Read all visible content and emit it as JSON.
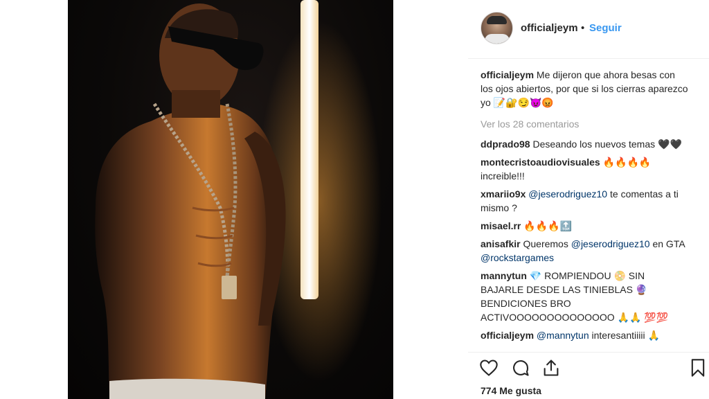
{
  "post": {
    "username": "officialjeym",
    "dot": "•",
    "follow_label": "Seguir",
    "caption_user": "officialjeym",
    "caption_text": "Me dijeron que ahora besas con los ojos abiertos, por que si los cierras aparezco yo",
    "caption_emojis": "📝🔐😏😈😡",
    "view_comments": "Ver los 28 comentarios",
    "likes": "774 Me gusta"
  },
  "comments": [
    {
      "user": "ddprado98",
      "text": "Deseando los nuevos temas",
      "emoji": "🖤🖤"
    },
    {
      "user": "montecristoaudiovisuales",
      "emoji": "🔥🔥🔥🔥",
      "text": "increible!!!"
    },
    {
      "user": "xmariio9x",
      "mention": "@jeserodriguez10",
      "text": "te comentas a ti mismo ?"
    },
    {
      "user": "misael.rr",
      "emoji": "🔥🔥🔥🔝"
    },
    {
      "user": "anisafkir",
      "text": "Queremos",
      "mention": "@jeserodriguez10",
      "text2": "en GTA",
      "mention2": "@rockstargames"
    },
    {
      "user": "mannytun",
      "text": "💎 ROMPIENDOU 📀 SIN BAJARLE DESDE LAS TINIEBLAS 🔮 BENDICIONES BRO ACTIVOOOOOOOOOOOOOO",
      "emoji": "🙏🙏 💯💯"
    },
    {
      "user": "officialjeym",
      "mention": "@mannytun",
      "text": "interesantiiiii 🙏"
    }
  ],
  "icons": [
    "heart-icon",
    "comment-icon",
    "share-icon",
    "bookmark-icon"
  ]
}
